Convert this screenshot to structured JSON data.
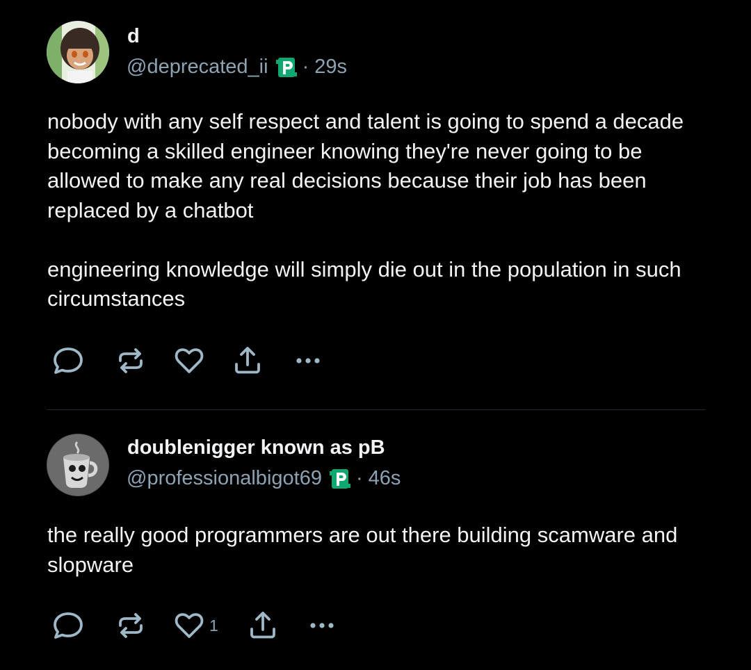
{
  "posts": [
    {
      "display_name": "d",
      "handle": "@deprecated_ii",
      "badge_icon": "p-badge-icon",
      "separator": "·",
      "time": "29s",
      "text": "nobody with any self respect and talent is going to spend a decade becoming a skilled engineer knowing they're never going to be allowed to make any real decisions because their job has been replaced by a chatbot\n\nengineering knowledge will simply die out in the population in such circumstances",
      "like_count": ""
    },
    {
      "display_name": "doublenigger known as pB",
      "handle": "@professionalbigot69",
      "badge_icon": "p-badge-icon",
      "separator": "·",
      "time": "46s",
      "text": "the really good programmers are out there building scamware and slopware",
      "like_count": "1"
    }
  ],
  "colors": {
    "background": "#000000",
    "text": "#f1f3f5",
    "muted": "#8da3b4",
    "icon": "#9fb8c8",
    "badge_green": "#0ea870",
    "divider": "#1e2a33"
  },
  "icons": [
    "reply-icon",
    "repost-icon",
    "like-icon",
    "share-icon",
    "more-icon"
  ]
}
